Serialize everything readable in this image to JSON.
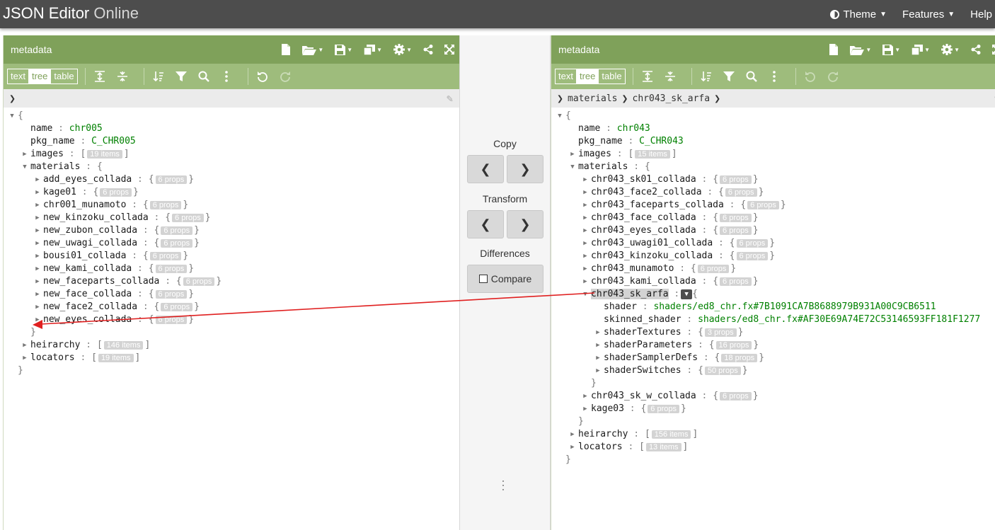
{
  "app": {
    "brand_main": "JSON Editor",
    "brand_sub": " Online",
    "nav": [
      "Theme",
      "Features",
      "Help"
    ]
  },
  "modes": [
    "text",
    "tree",
    "table"
  ],
  "left": {
    "title": "metadata",
    "breadcrumb": [],
    "rows": [
      {
        "d": 0,
        "t": "open",
        "type": "open",
        "b": "{"
      },
      {
        "d": 1,
        "t": "none",
        "type": "str",
        "k": "name",
        "v": "chr005"
      },
      {
        "d": 1,
        "t": "none",
        "type": "str",
        "k": "pkg_name",
        "v": "C_CHR005"
      },
      {
        "d": 1,
        "t": "closed",
        "type": "arr",
        "k": "images",
        "n": "19 items"
      },
      {
        "d": 1,
        "t": "open",
        "type": "openkey",
        "k": "materials",
        "b": "{"
      },
      {
        "d": 2,
        "t": "closed",
        "type": "obj",
        "k": "add_eyes_collada",
        "n": "6 props"
      },
      {
        "d": 2,
        "t": "closed",
        "type": "obj",
        "k": "kage01",
        "n": "6 props"
      },
      {
        "d": 2,
        "t": "closed",
        "type": "obj",
        "k": "chr001_munamoto",
        "n": "6 props"
      },
      {
        "d": 2,
        "t": "closed",
        "type": "obj",
        "k": "new_kinzoku_collada",
        "n": "6 props"
      },
      {
        "d": 2,
        "t": "closed",
        "type": "obj",
        "k": "new_zubon_collada",
        "n": "6 props"
      },
      {
        "d": 2,
        "t": "closed",
        "type": "obj",
        "k": "new_uwagi_collada",
        "n": "6 props"
      },
      {
        "d": 2,
        "t": "closed",
        "type": "obj",
        "k": "bousi01_collada",
        "n": "6 props"
      },
      {
        "d": 2,
        "t": "closed",
        "type": "obj",
        "k": "new_kami_collada",
        "n": "6 props"
      },
      {
        "d": 2,
        "t": "closed",
        "type": "obj",
        "k": "new_faceparts_collada",
        "n": "6 props"
      },
      {
        "d": 2,
        "t": "closed",
        "type": "obj",
        "k": "new_face_collada",
        "n": "6 props"
      },
      {
        "d": 2,
        "t": "closed",
        "type": "obj",
        "k": "new_face2_collada",
        "n": "6 props"
      },
      {
        "d": 2,
        "t": "closed",
        "type": "obj",
        "k": "new_eyes_collada",
        "n": "6 props"
      },
      {
        "d": 1,
        "t": "none",
        "type": "close",
        "b": "}"
      },
      {
        "d": 1,
        "t": "closed",
        "type": "arr",
        "k": "heirarchy",
        "n": "146 items"
      },
      {
        "d": 1,
        "t": "closed",
        "type": "arr",
        "k": "locators",
        "n": "19 items"
      },
      {
        "d": 0,
        "t": "none",
        "type": "close",
        "b": "}"
      }
    ]
  },
  "right": {
    "title": "metadata",
    "breadcrumb": [
      "materials",
      "chr043_sk_arfa"
    ],
    "rows": [
      {
        "d": 0,
        "t": "open",
        "type": "open",
        "b": "{"
      },
      {
        "d": 1,
        "t": "none",
        "type": "str",
        "k": "name",
        "v": "chr043"
      },
      {
        "d": 1,
        "t": "none",
        "type": "str",
        "k": "pkg_name",
        "v": "C_CHR043"
      },
      {
        "d": 1,
        "t": "closed",
        "type": "arr",
        "k": "images",
        "n": "15 items"
      },
      {
        "d": 1,
        "t": "open",
        "type": "openkey",
        "k": "materials",
        "b": "{"
      },
      {
        "d": 2,
        "t": "closed",
        "type": "obj",
        "k": "chr043_sk01_collada",
        "n": "6 props"
      },
      {
        "d": 2,
        "t": "closed",
        "type": "obj",
        "k": "chr043_face2_collada",
        "n": "6 props"
      },
      {
        "d": 2,
        "t": "closed",
        "type": "obj",
        "k": "chr043_faceparts_collada",
        "n": "6 props"
      },
      {
        "d": 2,
        "t": "closed",
        "type": "obj",
        "k": "chr043_face_collada",
        "n": "6 props"
      },
      {
        "d": 2,
        "t": "closed",
        "type": "obj",
        "k": "chr043_eyes_collada",
        "n": "6 props"
      },
      {
        "d": 2,
        "t": "closed",
        "type": "obj",
        "k": "chr043_uwagi01_collada",
        "n": "6 props"
      },
      {
        "d": 2,
        "t": "closed",
        "type": "obj",
        "k": "chr043_kinzoku_collada",
        "n": "6 props"
      },
      {
        "d": 2,
        "t": "closed",
        "type": "obj",
        "k": "chr043_munamoto",
        "n": "6 props"
      },
      {
        "d": 2,
        "t": "closed",
        "type": "obj",
        "k": "chr043_kami_collada",
        "n": "6 props"
      },
      {
        "d": 2,
        "t": "open",
        "type": "openkey",
        "k": "chr043_sk_arfa",
        "b": "{",
        "selected": true
      },
      {
        "d": 3,
        "t": "none",
        "type": "str",
        "k": "shader",
        "v": "shaders/ed8_chr.fx#7B1091CA7B8688979B931A00C9CB6511"
      },
      {
        "d": 3,
        "t": "none",
        "type": "str",
        "k": "skinned_shader",
        "v": "shaders/ed8_chr.fx#AF30E69A74E72C53146593FF181F1277"
      },
      {
        "d": 3,
        "t": "closed",
        "type": "obj",
        "k": "shaderTextures",
        "n": "3 props"
      },
      {
        "d": 3,
        "t": "closed",
        "type": "obj",
        "k": "shaderParameters",
        "n": "16 props"
      },
      {
        "d": 3,
        "t": "closed",
        "type": "obj",
        "k": "shaderSamplerDefs",
        "n": "18 props"
      },
      {
        "d": 3,
        "t": "closed",
        "type": "obj",
        "k": "shaderSwitches",
        "n": "50 props"
      },
      {
        "d": 2,
        "t": "none",
        "type": "close",
        "b": "}"
      },
      {
        "d": 2,
        "t": "closed",
        "type": "obj",
        "k": "chr043_sk_w_collada",
        "n": "6 props"
      },
      {
        "d": 2,
        "t": "closed",
        "type": "obj",
        "k": "kage03",
        "n": "6 props"
      },
      {
        "d": 1,
        "t": "none",
        "type": "close",
        "b": "}"
      },
      {
        "d": 1,
        "t": "closed",
        "type": "arr",
        "k": "heirarchy",
        "n": "156 items"
      },
      {
        "d": 1,
        "t": "closed",
        "type": "arr",
        "k": "locators",
        "n": "13 items"
      },
      {
        "d": 0,
        "t": "none",
        "type": "close",
        "b": "}"
      }
    ]
  },
  "middle": {
    "copy_label": "Copy",
    "transform_label": "Transform",
    "differences_label": "Differences",
    "compare_label": "Compare",
    "left_glyph": "❮",
    "right_glyph": "❯"
  },
  "colors": {
    "topbar": "#4d4d4d",
    "menu": "#7fa15a",
    "submenu": "#9ebc7c",
    "string_value": "#008000",
    "arrow": "#e02020"
  }
}
